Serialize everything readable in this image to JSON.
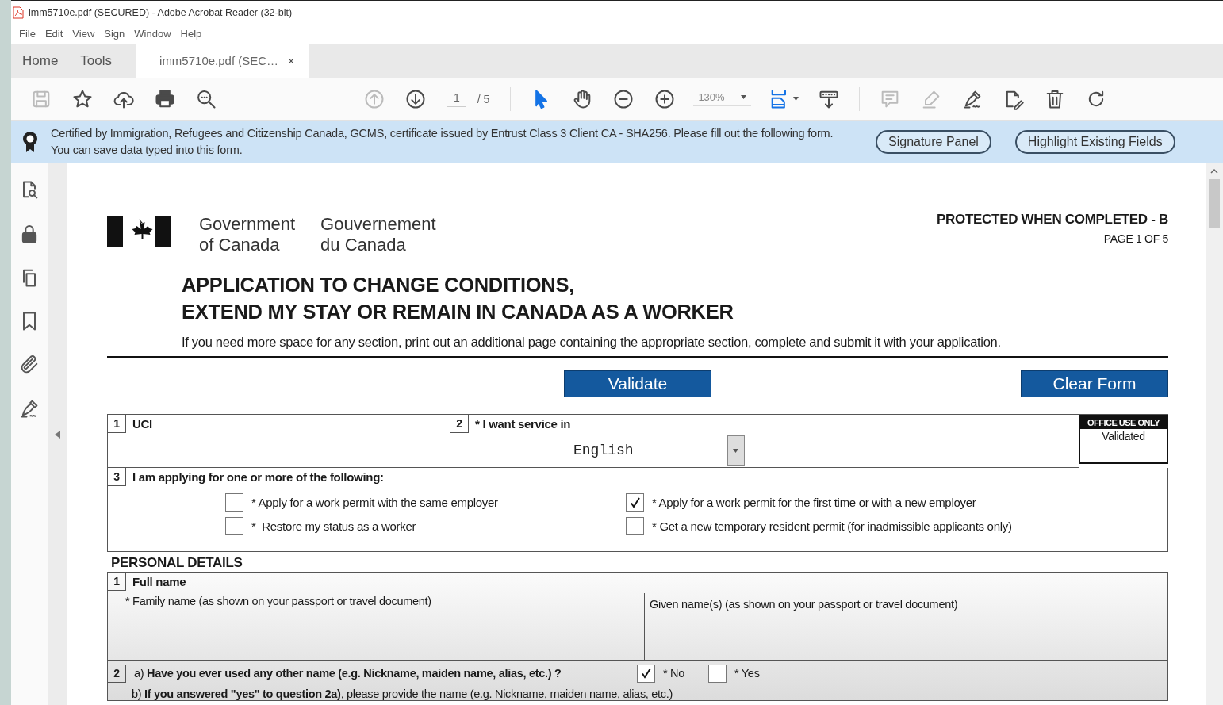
{
  "window": {
    "title": "imm5710e.pdf (SECURED) - Adobe Acrobat Reader (32-bit)"
  },
  "menu": [
    "File",
    "Edit",
    "View",
    "Sign",
    "Window",
    "Help"
  ],
  "tabs": [
    {
      "label": "Home",
      "selected": false
    },
    {
      "label": "Tools",
      "selected": false
    },
    {
      "label": "imm5710e.pdf (SEC…",
      "selected": true,
      "close": "×"
    }
  ],
  "toolbar": {
    "items": [
      {
        "kind": "save",
        "disabled": true
      },
      {
        "kind": "star",
        "disabled": false
      },
      {
        "kind": "upload",
        "disabled": false
      },
      {
        "kind": "print",
        "disabled": false
      },
      {
        "kind": "find",
        "disabled": false
      },
      {
        "kind": "prev",
        "disabled": true
      },
      {
        "kind": "next",
        "disabled": false
      },
      {
        "kind": "page",
        "value": "1",
        "total": "/ 5"
      },
      {
        "kind": "separator"
      },
      {
        "kind": "select",
        "disabled": false
      },
      {
        "kind": "hand",
        "disabled": false
      },
      {
        "kind": "zoom-out",
        "disabled": false
      },
      {
        "kind": "zoom-in",
        "disabled": false
      },
      {
        "kind": "zoom",
        "value": "130%"
      },
      {
        "kind": "fit",
        "disabled": false
      },
      {
        "kind": "scroll",
        "disabled": false
      },
      {
        "kind": "separator"
      },
      {
        "kind": "comment",
        "disabled": true
      },
      {
        "kind": "highlight",
        "disabled": true
      },
      {
        "kind": "sign",
        "disabled": false
      },
      {
        "kind": "edit",
        "disabled": false
      },
      {
        "kind": "delete",
        "disabled": false
      },
      {
        "kind": "rotate",
        "disabled": false
      }
    ]
  },
  "banner": {
    "text": "Certified by Immigration, Refugees and Citizenship Canada, GCMS, certificate issued by Entrust Class 3 Client CA - SHA256.  Please fill out the following form. You can save data typed into this form.",
    "buttons": [
      "Signature Panel",
      "Highlight Existing Fields"
    ]
  },
  "sidebar": {
    "tools": [
      {
        "kind": "pages"
      },
      {
        "kind": "lock"
      },
      {
        "kind": "copy"
      },
      {
        "kind": "bookmark"
      },
      {
        "kind": "attachment"
      },
      {
        "kind": "sign"
      }
    ]
  },
  "document": {
    "gov_en": [
      "Government",
      "of Canada"
    ],
    "gov_fr": [
      "Gouvernement",
      "du Canada"
    ],
    "protected": "PROTECTED WHEN COMPLETED - B",
    "page_label": "PAGE 1 OF 5",
    "title": [
      "APPLICATION TO CHANGE CONDITIONS,",
      "EXTEND MY STAY OR REMAIN IN CANADA AS A WORKER"
    ],
    "note": "If you need more space for any section, print out an additional page containing the appropriate section, complete and submit it with your application.",
    "buttons": [
      "Validate",
      "Clear Form"
    ],
    "uci": {
      "number": "1",
      "label": "UCI"
    },
    "service": {
      "number": "2",
      "label": "* I want service in",
      "value": "English"
    },
    "office": {
      "label": "OFFICE USE ONLY",
      "value": "Validated"
    },
    "applying": {
      "number": "3",
      "label": "I am applying for one or more of the following:",
      "options": [
        {
          "label": "* Apply for a work permit with the same employer",
          "checked": false
        },
        {
          "label": "* Apply for a work permit for the first time or with a new employer",
          "checked": true
        },
        {
          "label": "*  Restore my status as a worker",
          "checked": false
        },
        {
          "label": "* Get a new temporary resident permit (for inadmissible applicants only)",
          "checked": false
        }
      ]
    },
    "personal": {
      "heading": "PERSONAL DETAILS",
      "full_name": {
        "number": "1",
        "label": "Full name",
        "family": "* Family name (as shown on your passport or travel document)",
        "given": "Given name(s) (as shown on your passport or travel document)"
      },
      "other_name": {
        "number": "2",
        "question": "a) **Have you ever used any other name (e.g. Nickname, maiden name, alias, etc.) ?**",
        "options": [
          {
            "label": "* No",
            "checked": true
          },
          {
            "label": "* Yes",
            "checked": false
          }
        ],
        "followup": "b) **If you answered \"yes\" to question 2a)**, please provide the name (e.g. Nickname, maiden name, alias, etc.)"
      }
    }
  }
}
